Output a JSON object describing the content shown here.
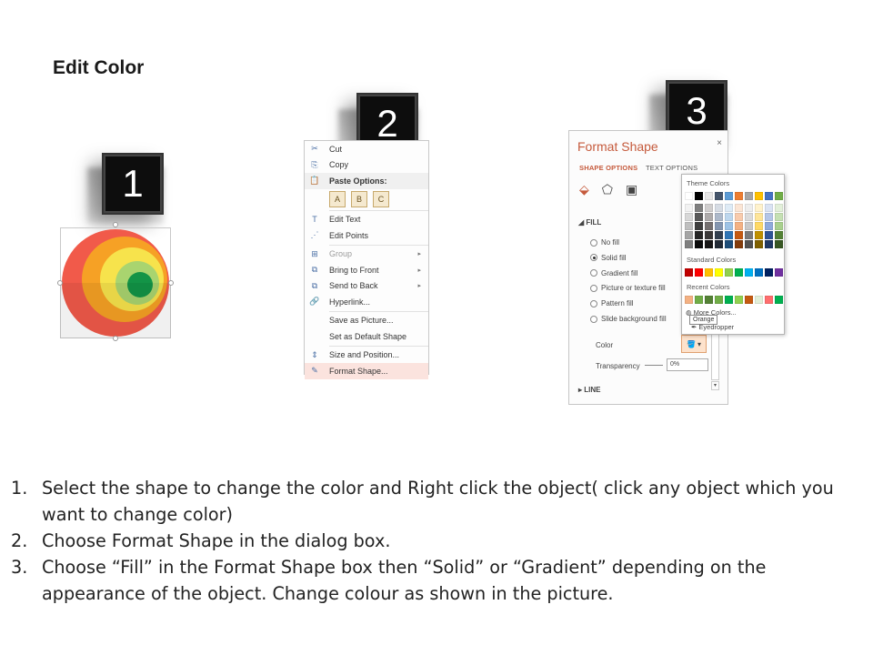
{
  "title": "Edit Color",
  "steps": {
    "one": "1",
    "two": "2",
    "three": "3"
  },
  "context_menu": {
    "items": [
      {
        "icon": "✂",
        "label": "Cut",
        "state": "normal"
      },
      {
        "icon": "⎘",
        "label": "Copy",
        "state": "normal"
      },
      {
        "icon": "📋",
        "label": "Paste Options:",
        "state": "bold"
      },
      {
        "icon": "T",
        "label": "Edit Text",
        "state": "normal"
      },
      {
        "icon": "⋰",
        "label": "Edit Points",
        "state": "normal"
      },
      {
        "icon": "⊞",
        "label": "Group",
        "state": "disabled",
        "submenu": "▸"
      },
      {
        "icon": "⧉",
        "label": "Bring to Front",
        "state": "normal",
        "submenu": "▸"
      },
      {
        "icon": "⧉",
        "label": "Send to Back",
        "state": "normal",
        "submenu": "▸"
      },
      {
        "icon": "🔗",
        "label": "Hyperlink...",
        "state": "normal"
      },
      {
        "icon": "",
        "label": "Save as Picture...",
        "state": "normal"
      },
      {
        "icon": "",
        "label": "Set as Default Shape",
        "state": "normal"
      },
      {
        "icon": "⇕",
        "label": "Size and Position...",
        "state": "normal"
      },
      {
        "icon": "✎",
        "label": "Format Shape...",
        "state": "highlight"
      }
    ],
    "paste_icons": [
      "A",
      "B",
      "C"
    ]
  },
  "format_panel": {
    "title": "Format Shape",
    "close": "×",
    "tab_active": "SHAPE OPTIONS",
    "tab_other": "TEXT OPTIONS",
    "fill_section": "FILL",
    "fill_options": [
      {
        "label": "No fill",
        "selected": false
      },
      {
        "label": "Solid fill",
        "selected": true
      },
      {
        "label": "Gradient fill",
        "selected": false
      },
      {
        "label": "Picture or texture fill",
        "selected": false
      },
      {
        "label": "Pattern fill",
        "selected": false
      },
      {
        "label": "Slide background fill",
        "selected": false
      }
    ],
    "color_label": "Color",
    "transparency_label": "Transparency",
    "transparency_value": "0%",
    "line_section": "LINE"
  },
  "palette": {
    "theme_header": "Theme Colors",
    "standard_header": "Standard Colors",
    "recent_header": "Recent Colors",
    "more_colors": "More Colors...",
    "eyedropper": "Eyedropper",
    "tooltip": "Orange",
    "theme_top": [
      "#ffffff",
      "#000000",
      "#e7e6e6",
      "#44546a",
      "#5b9bd5",
      "#ed7d31",
      "#a5a5a5",
      "#ffc000",
      "#4472c4",
      "#70ad47"
    ],
    "theme_shades": [
      [
        "#f2f2f2",
        "#7f7f7f",
        "#d0cece",
        "#d6dce4",
        "#deebf6",
        "#fbe5d5",
        "#ededed",
        "#fff2cc",
        "#dae3f3",
        "#e2efd9"
      ],
      [
        "#d8d8d8",
        "#595959",
        "#aeabab",
        "#adb9ca",
        "#bdd7ee",
        "#f8cbad",
        "#dbdbdb",
        "#fee599",
        "#b4c6e7",
        "#c5e0b3"
      ],
      [
        "#bfbfbf",
        "#3f3f3f",
        "#757070",
        "#8496b0",
        "#9dc3e6",
        "#f4b183",
        "#c9c9c9",
        "#ffd965",
        "#8eaadb",
        "#a8d08d"
      ],
      [
        "#a5a5a5",
        "#262626",
        "#3a3838",
        "#323f4f",
        "#2e75b5",
        "#c55a11",
        "#7b7b7b",
        "#bf9000",
        "#2f5496",
        "#538135"
      ],
      [
        "#7f7f7f",
        "#0c0c0c",
        "#171616",
        "#222a35",
        "#1e4e79",
        "#833c0b",
        "#525252",
        "#7f6000",
        "#1f3864",
        "#375623"
      ]
    ],
    "standard": [
      "#c00000",
      "#ff0000",
      "#ffc000",
      "#ffff00",
      "#92d050",
      "#00b050",
      "#00b0f0",
      "#0070c0",
      "#002060",
      "#7030a0"
    ],
    "recent": [
      "#f4b183",
      "#70ad47",
      "#548235",
      "#70ad47",
      "#00b050",
      "#92d050",
      "#c55a11",
      "#e2efd9",
      "#ff6e6e",
      "#00b050"
    ]
  },
  "instructions": [
    {
      "num": "1.",
      "text": "Select the shape to change the color and Right click the object( click any object which you want to change color)"
    },
    {
      "num": "2.",
      "text": "Choose Format Shape in the dialog box."
    },
    {
      "num": "3.",
      "text": "Choose “Fill” in the Format Shape box then “Solid” or “Gradient” depending on the appearance of the object. Change colour as shown in the picture."
    }
  ],
  "target_colors": [
    "#f15a4a",
    "#f6a125",
    "#f7e34c",
    "#a9d46f",
    "#139447"
  ]
}
